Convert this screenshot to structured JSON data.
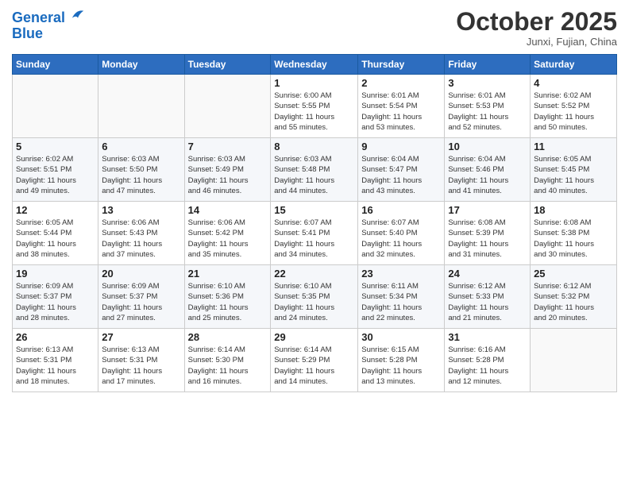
{
  "header": {
    "logo_line1": "General",
    "logo_line2": "Blue",
    "month_title": "October 2025",
    "subtitle": "Junxi, Fujian, China"
  },
  "days_of_week": [
    "Sunday",
    "Monday",
    "Tuesday",
    "Wednesday",
    "Thursday",
    "Friday",
    "Saturday"
  ],
  "weeks": [
    [
      {
        "day": "",
        "info": ""
      },
      {
        "day": "",
        "info": ""
      },
      {
        "day": "",
        "info": ""
      },
      {
        "day": "1",
        "info": "Sunrise: 6:00 AM\nSunset: 5:55 PM\nDaylight: 11 hours\nand 55 minutes."
      },
      {
        "day": "2",
        "info": "Sunrise: 6:01 AM\nSunset: 5:54 PM\nDaylight: 11 hours\nand 53 minutes."
      },
      {
        "day": "3",
        "info": "Sunrise: 6:01 AM\nSunset: 5:53 PM\nDaylight: 11 hours\nand 52 minutes."
      },
      {
        "day": "4",
        "info": "Sunrise: 6:02 AM\nSunset: 5:52 PM\nDaylight: 11 hours\nand 50 minutes."
      }
    ],
    [
      {
        "day": "5",
        "info": "Sunrise: 6:02 AM\nSunset: 5:51 PM\nDaylight: 11 hours\nand 49 minutes."
      },
      {
        "day": "6",
        "info": "Sunrise: 6:03 AM\nSunset: 5:50 PM\nDaylight: 11 hours\nand 47 minutes."
      },
      {
        "day": "7",
        "info": "Sunrise: 6:03 AM\nSunset: 5:49 PM\nDaylight: 11 hours\nand 46 minutes."
      },
      {
        "day": "8",
        "info": "Sunrise: 6:03 AM\nSunset: 5:48 PM\nDaylight: 11 hours\nand 44 minutes."
      },
      {
        "day": "9",
        "info": "Sunrise: 6:04 AM\nSunset: 5:47 PM\nDaylight: 11 hours\nand 43 minutes."
      },
      {
        "day": "10",
        "info": "Sunrise: 6:04 AM\nSunset: 5:46 PM\nDaylight: 11 hours\nand 41 minutes."
      },
      {
        "day": "11",
        "info": "Sunrise: 6:05 AM\nSunset: 5:45 PM\nDaylight: 11 hours\nand 40 minutes."
      }
    ],
    [
      {
        "day": "12",
        "info": "Sunrise: 6:05 AM\nSunset: 5:44 PM\nDaylight: 11 hours\nand 38 minutes."
      },
      {
        "day": "13",
        "info": "Sunrise: 6:06 AM\nSunset: 5:43 PM\nDaylight: 11 hours\nand 37 minutes."
      },
      {
        "day": "14",
        "info": "Sunrise: 6:06 AM\nSunset: 5:42 PM\nDaylight: 11 hours\nand 35 minutes."
      },
      {
        "day": "15",
        "info": "Sunrise: 6:07 AM\nSunset: 5:41 PM\nDaylight: 11 hours\nand 34 minutes."
      },
      {
        "day": "16",
        "info": "Sunrise: 6:07 AM\nSunset: 5:40 PM\nDaylight: 11 hours\nand 32 minutes."
      },
      {
        "day": "17",
        "info": "Sunrise: 6:08 AM\nSunset: 5:39 PM\nDaylight: 11 hours\nand 31 minutes."
      },
      {
        "day": "18",
        "info": "Sunrise: 6:08 AM\nSunset: 5:38 PM\nDaylight: 11 hours\nand 30 minutes."
      }
    ],
    [
      {
        "day": "19",
        "info": "Sunrise: 6:09 AM\nSunset: 5:37 PM\nDaylight: 11 hours\nand 28 minutes."
      },
      {
        "day": "20",
        "info": "Sunrise: 6:09 AM\nSunset: 5:37 PM\nDaylight: 11 hours\nand 27 minutes."
      },
      {
        "day": "21",
        "info": "Sunrise: 6:10 AM\nSunset: 5:36 PM\nDaylight: 11 hours\nand 25 minutes."
      },
      {
        "day": "22",
        "info": "Sunrise: 6:10 AM\nSunset: 5:35 PM\nDaylight: 11 hours\nand 24 minutes."
      },
      {
        "day": "23",
        "info": "Sunrise: 6:11 AM\nSunset: 5:34 PM\nDaylight: 11 hours\nand 22 minutes."
      },
      {
        "day": "24",
        "info": "Sunrise: 6:12 AM\nSunset: 5:33 PM\nDaylight: 11 hours\nand 21 minutes."
      },
      {
        "day": "25",
        "info": "Sunrise: 6:12 AM\nSunset: 5:32 PM\nDaylight: 11 hours\nand 20 minutes."
      }
    ],
    [
      {
        "day": "26",
        "info": "Sunrise: 6:13 AM\nSunset: 5:31 PM\nDaylight: 11 hours\nand 18 minutes."
      },
      {
        "day": "27",
        "info": "Sunrise: 6:13 AM\nSunset: 5:31 PM\nDaylight: 11 hours\nand 17 minutes."
      },
      {
        "day": "28",
        "info": "Sunrise: 6:14 AM\nSunset: 5:30 PM\nDaylight: 11 hours\nand 16 minutes."
      },
      {
        "day": "29",
        "info": "Sunrise: 6:14 AM\nSunset: 5:29 PM\nDaylight: 11 hours\nand 14 minutes."
      },
      {
        "day": "30",
        "info": "Sunrise: 6:15 AM\nSunset: 5:28 PM\nDaylight: 11 hours\nand 13 minutes."
      },
      {
        "day": "31",
        "info": "Sunrise: 6:16 AM\nSunset: 5:28 PM\nDaylight: 11 hours\nand 12 minutes."
      },
      {
        "day": "",
        "info": ""
      }
    ]
  ]
}
